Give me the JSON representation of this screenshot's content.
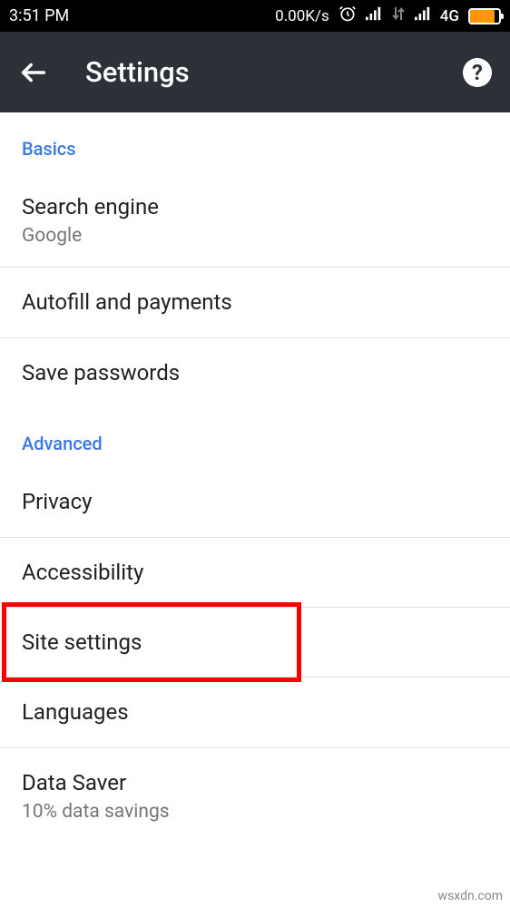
{
  "statusbar": {
    "time": "3:51 PM",
    "netspeed": "0.00K/s",
    "net4g": "4G"
  },
  "appbar": {
    "title": "Settings"
  },
  "sections": {
    "basics": {
      "header": "Basics",
      "search_engine": {
        "title": "Search engine",
        "value": "Google"
      },
      "autofill": {
        "title": "Autofill and payments"
      },
      "passwords": {
        "title": "Save passwords"
      }
    },
    "advanced": {
      "header": "Advanced",
      "privacy": {
        "title": "Privacy"
      },
      "accessibility": {
        "title": "Accessibility"
      },
      "site_settings": {
        "title": "Site settings"
      },
      "languages": {
        "title": "Languages"
      },
      "data_saver": {
        "title": "Data Saver",
        "value": "10% data savings"
      }
    }
  },
  "watermark": "wsxdn.com"
}
